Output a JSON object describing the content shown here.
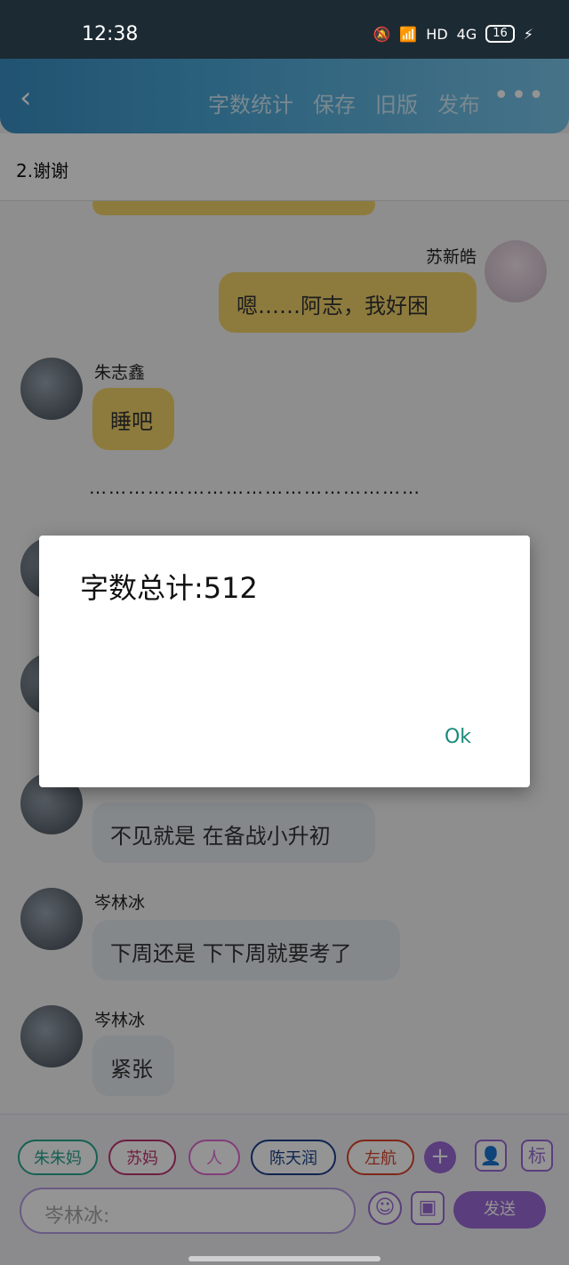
{
  "status_bar": {
    "time": "12:38",
    "network_badge": "HD",
    "network_type": "4G",
    "battery": "16"
  },
  "app_bar": {
    "actions": [
      "字数统计",
      "保存",
      "旧版",
      "发布"
    ]
  },
  "chapter_title": "2.谢谢",
  "messages": [
    {
      "name": "苏新皓",
      "text": "嗯……阿志，我好困",
      "side": "right",
      "color": "yellow"
    },
    {
      "name": "朱志鑫",
      "text": "睡吧",
      "side": "left",
      "color": "yellow"
    },
    {
      "text": "……………………………………………"
    },
    {
      "name": "",
      "text": "不见就是 在备战小升初",
      "side": "left",
      "color": "grey"
    },
    {
      "name": "岑林冰",
      "text": "下周还是 下下周就要考了",
      "side": "left",
      "color": "grey"
    },
    {
      "name": "岑林冰",
      "text": "紧张",
      "side": "left",
      "color": "grey"
    }
  ],
  "dialog": {
    "title": "字数总计:512",
    "ok_label": "Ok"
  },
  "composer": {
    "chips": [
      "朱朱妈",
      "苏妈",
      "人",
      "陈天润",
      "左航"
    ],
    "profile_button": "",
    "tag_button": "标",
    "input_value": "岑林冰:",
    "send_label": "发送"
  },
  "colors": {
    "app_bar": "#4aa6d6",
    "bubble_yellow": "#f3d46c",
    "bubble_grey": "#e6ebef",
    "accent_purple": "#9b6ad6",
    "ok_text": "#1a8a7c"
  }
}
